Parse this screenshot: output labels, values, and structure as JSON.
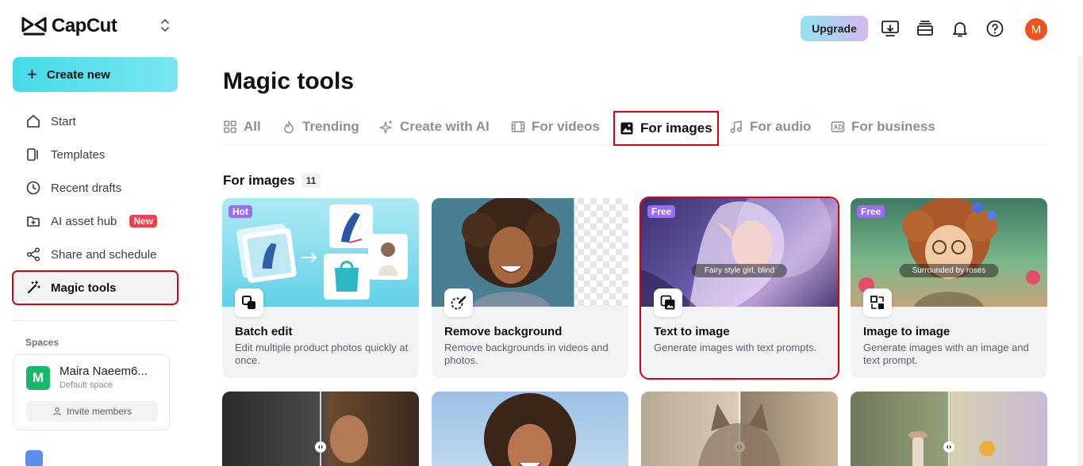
{
  "brand": {
    "name": "CapCut"
  },
  "sidebar": {
    "create_label": "Create new",
    "items": [
      {
        "label": "Start",
        "icon": "home-icon"
      },
      {
        "label": "Templates",
        "icon": "templates-icon"
      },
      {
        "label": "Recent drafts",
        "icon": "clock-icon"
      },
      {
        "label": "AI asset hub",
        "icon": "asset-hub-icon",
        "badge": "New"
      },
      {
        "label": "Share and schedule",
        "icon": "share-icon"
      },
      {
        "label": "Magic tools",
        "icon": "magic-wand-icon",
        "active": true
      }
    ],
    "spaces_label": "Spaces",
    "space": {
      "initial": "M",
      "name": "Maira Naeem6...",
      "sub": "Default space",
      "invite_label": "Invite members"
    }
  },
  "topbar": {
    "upgrade_label": "Upgrade",
    "avatar_initial": "M"
  },
  "main": {
    "title": "Magic tools",
    "tabs": [
      {
        "label": "All"
      },
      {
        "label": "Trending"
      },
      {
        "label": "Create with AI"
      },
      {
        "label": "For videos"
      },
      {
        "label": "For images",
        "active": true
      },
      {
        "label": "For audio"
      },
      {
        "label": "For business"
      }
    ],
    "section_title": "For images",
    "section_count": "11",
    "cards": [
      {
        "tag": "Hot",
        "title": "Batch edit",
        "desc": "Edit multiple product photos quickly at once."
      },
      {
        "tag": "",
        "title": "Remove background",
        "desc": "Remove backgrounds in videos and photos."
      },
      {
        "tag": "Free",
        "title": "Text to image",
        "desc": "Generate images with text prompts.",
        "prompt": "Fairy style girl, blind"
      },
      {
        "tag": "Free",
        "title": "Image to image",
        "desc": "Generate images with an image and text prompt.",
        "prompt": "Surrounded by roses"
      }
    ]
  },
  "colors": {
    "accent": "#45dbe8",
    "highlight": "#e0000b",
    "tag": "#9b6cf0",
    "new_badge": "#ff3b4a"
  }
}
